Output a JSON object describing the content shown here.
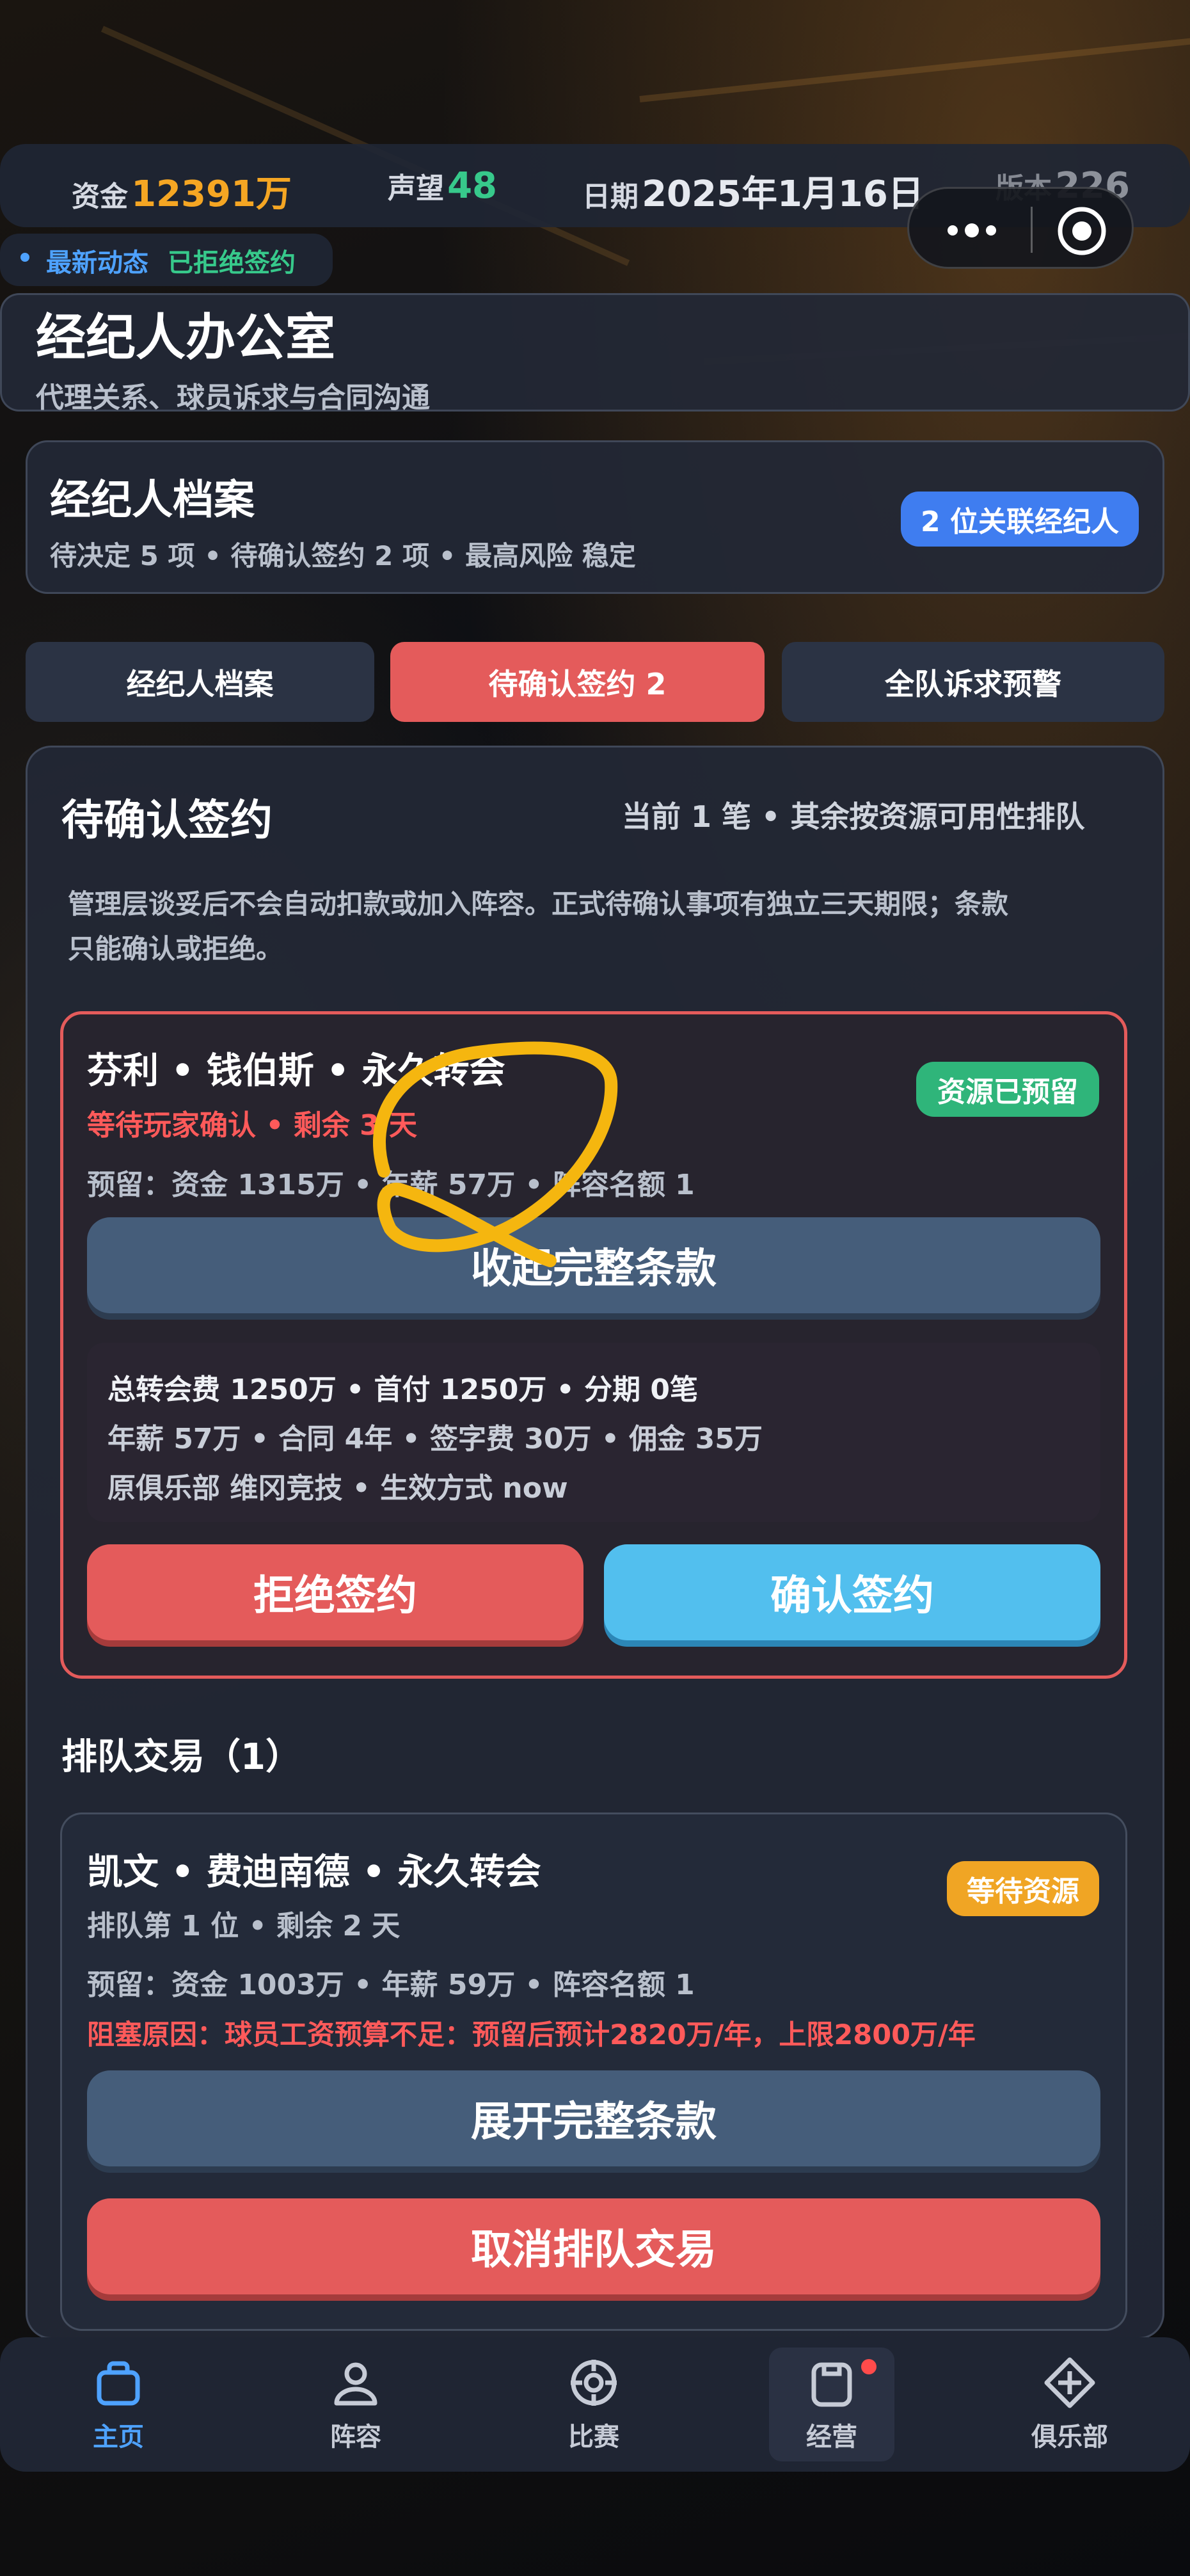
{
  "status": {
    "funds_label": "资金",
    "funds_value": "12391万",
    "reputation_label": "声望",
    "reputation_value": "48",
    "date_label": "日期",
    "date_value": "2025年1月16日",
    "version_label": "版本",
    "version_value": "226"
  },
  "news": {
    "label": "最新动态",
    "text": "已拒绝签约"
  },
  "page": {
    "title": "经纪人办公室",
    "subtitle": "代理关系、球员诉求与合同沟通"
  },
  "profile": {
    "title": "经纪人档案",
    "summary": "待决定 5 项 • 待确认签约 2 项 • 最高风险 稳定",
    "badge": "2 位关联经纪人"
  },
  "tabs": [
    {
      "label": "经纪人档案"
    },
    {
      "label": "待确认签约 2"
    },
    {
      "label": "全队诉求预警"
    }
  ],
  "pending": {
    "title": "待确认签约",
    "meta": "当前 1 笔 • 其余按资源可用性排队",
    "desc_line1": "管理层谈妥后不会自动扣款或加入阵容。正式待确认事项有独立三天期限；条款",
    "desc_line2": "只能确认或拒绝。",
    "deal": {
      "title": "芬利 • 钱伯斯 • 永久转会",
      "status": "等待玩家确认 • 剩余 3 天",
      "badge": "资源已预留",
      "reserve": "预留：资金 1315万 • 年薪 57万 • 阵容名额 1",
      "collapse_label": "收起完整条款",
      "terms_line1": "总转会费 1250万 • 首付 1250万 • 分期 0笔",
      "terms_line2": "年薪 57万 • 合同 4年 • 签字费 30万 • 佣金 35万",
      "terms_line3": "原俱乐部 维冈竞技 • 生效方式 now",
      "reject_label": "拒绝签约",
      "confirm_label": "确认签约"
    }
  },
  "queue": {
    "title": "排队交易（1）",
    "deal": {
      "title": "凯文 • 费迪南德 • 永久转会",
      "status": "排队第 1 位 • 剩余 2 天",
      "badge": "等待资源",
      "reserve": "预留：资金 1003万 • 年薪 59万 • 阵容名额 1",
      "blocked": "阻塞原因：球员工资预算不足：预留后预计2820万/年，上限2800万/年",
      "expand_label": "展开完整条款",
      "cancel_label": "取消排队交易"
    }
  },
  "nav": [
    {
      "label": "主页",
      "icon": "home-icon"
    },
    {
      "label": "阵容",
      "icon": "user-icon"
    },
    {
      "label": "比赛",
      "icon": "target-icon"
    },
    {
      "label": "经营",
      "icon": "clipboard-icon"
    },
    {
      "label": "俱乐部",
      "icon": "diamond-plus-icon"
    }
  ],
  "colors": {
    "funds": "#f5a623",
    "reputation": "#37c98b",
    "accent_red": "#e45b5b",
    "accent_blue": "#52bfee",
    "nav_active": "#4ea2ff",
    "badge_green": "#2fb57a",
    "badge_orange": "#f0a524"
  }
}
